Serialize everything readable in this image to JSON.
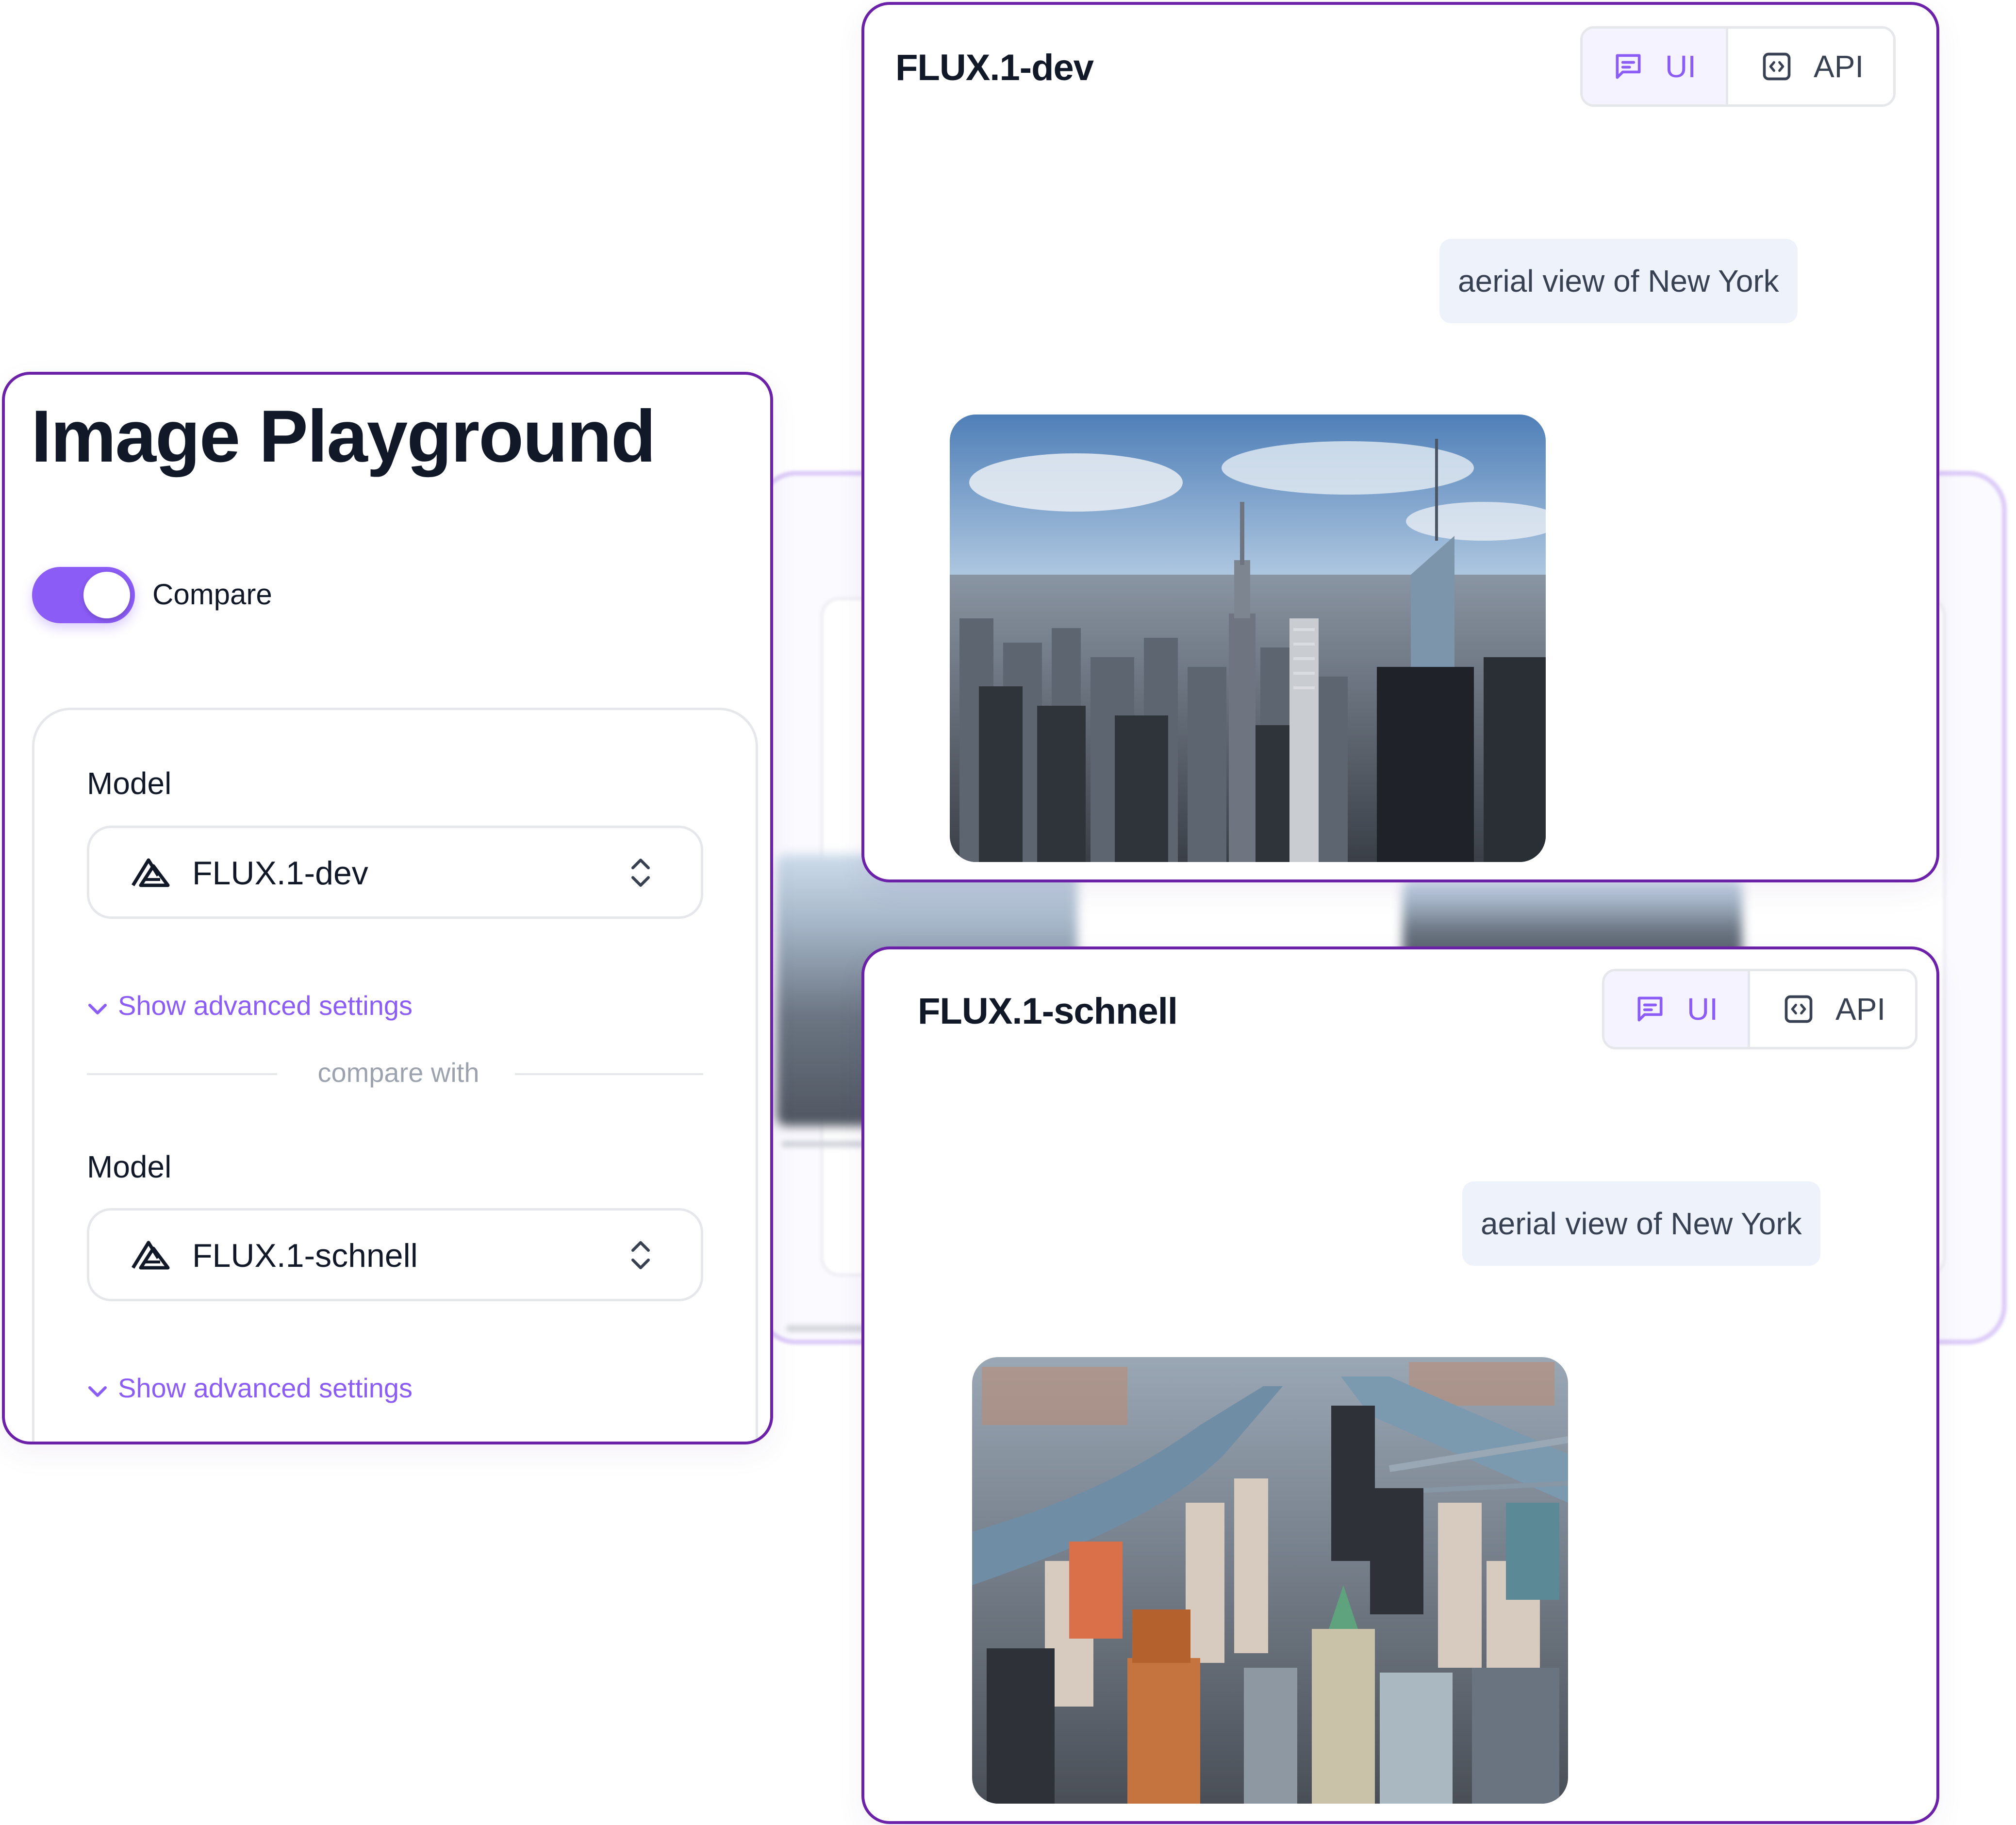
{
  "left_panel": {
    "title": "Image Playground",
    "compare_toggle": {
      "label": "Compare",
      "on": true
    },
    "primary": {
      "label": "Model",
      "value": "FLUX.1-dev",
      "advanced_label": "Show advanced settings"
    },
    "divider_label": "compare with",
    "secondary": {
      "label": "Model",
      "value": "FLUX.1-schnell",
      "advanced_label": "Show advanced settings"
    }
  },
  "results": [
    {
      "model": "FLUX.1-dev",
      "tabs": {
        "ui": "UI",
        "api": "API",
        "active": "ui"
      },
      "prompt": "aerial view of New York"
    },
    {
      "model": "FLUX.1-schnell",
      "tabs": {
        "ui": "UI",
        "api": "API",
        "active": "ui"
      },
      "prompt": "aerial view of New York"
    }
  ],
  "colors": {
    "accent": "#8b5cf6",
    "card_border": "#6b21a8",
    "prompt_bg": "#eef2fb"
  },
  "icons": {
    "model_logo": "triangle-logo-icon",
    "select_chevron": "chevron-updown-icon",
    "advanced_chevron": "chevron-down-icon",
    "ui_tab": "message-square-icon",
    "api_tab": "code-brackets-icon"
  }
}
